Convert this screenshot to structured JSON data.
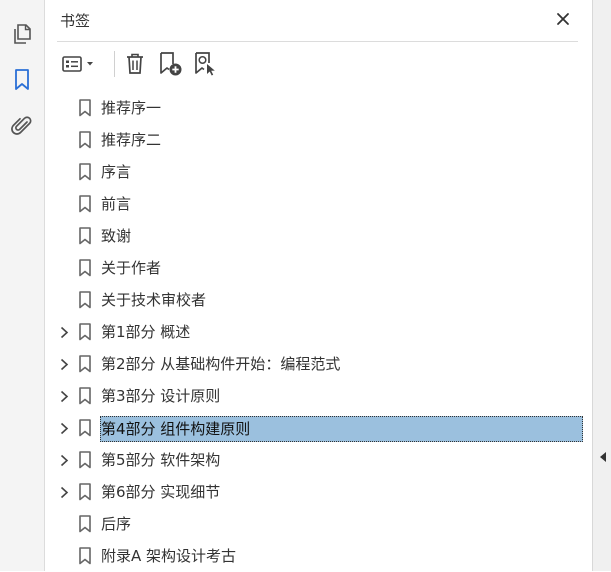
{
  "panel": {
    "title": "书签",
    "close_icon": "close-icon"
  },
  "rail": {
    "items": [
      {
        "name": "pages",
        "icon": "pages-icon",
        "active": false
      },
      {
        "name": "bookmarks",
        "icon": "bookmark-icon",
        "active": true
      },
      {
        "name": "attachments",
        "icon": "paperclip-icon",
        "active": false
      }
    ]
  },
  "toolbar": {
    "options_icon": "options-menu-icon",
    "delete_icon": "trash-icon",
    "new_bookmark_icon": "new-bookmark-icon",
    "find_bookmark_icon": "find-current-bookmark-icon"
  },
  "bookmarks": [
    {
      "label": "推荐序一",
      "expandable": false,
      "selected": false
    },
    {
      "label": "推荐序二",
      "expandable": false,
      "selected": false
    },
    {
      "label": "序言",
      "expandable": false,
      "selected": false
    },
    {
      "label": "前言",
      "expandable": false,
      "selected": false
    },
    {
      "label": "致谢",
      "expandable": false,
      "selected": false
    },
    {
      "label": "关于作者",
      "expandable": false,
      "selected": false
    },
    {
      "label": "关于技术审校者",
      "expandable": false,
      "selected": false
    },
    {
      "label": "第1部分 概述",
      "expandable": true,
      "selected": false
    },
    {
      "label": "第2部分 从基础构件开始：编程范式",
      "expandable": true,
      "selected": false
    },
    {
      "label": "第3部分 设计原则",
      "expandable": true,
      "selected": false
    },
    {
      "label": "第4部分 组件构建原则",
      "expandable": true,
      "selected": true
    },
    {
      "label": "第5部分 软件架构",
      "expandable": true,
      "selected": false
    },
    {
      "label": "第6部分 实现细节",
      "expandable": true,
      "selected": false
    },
    {
      "label": "后序",
      "expandable": false,
      "selected": false
    },
    {
      "label": "附录A 架构设计考古",
      "expandable": false,
      "selected": false
    }
  ],
  "colors": {
    "accent": "#2a6fd6",
    "selection": "#9bc0de",
    "icon": "#555555"
  }
}
